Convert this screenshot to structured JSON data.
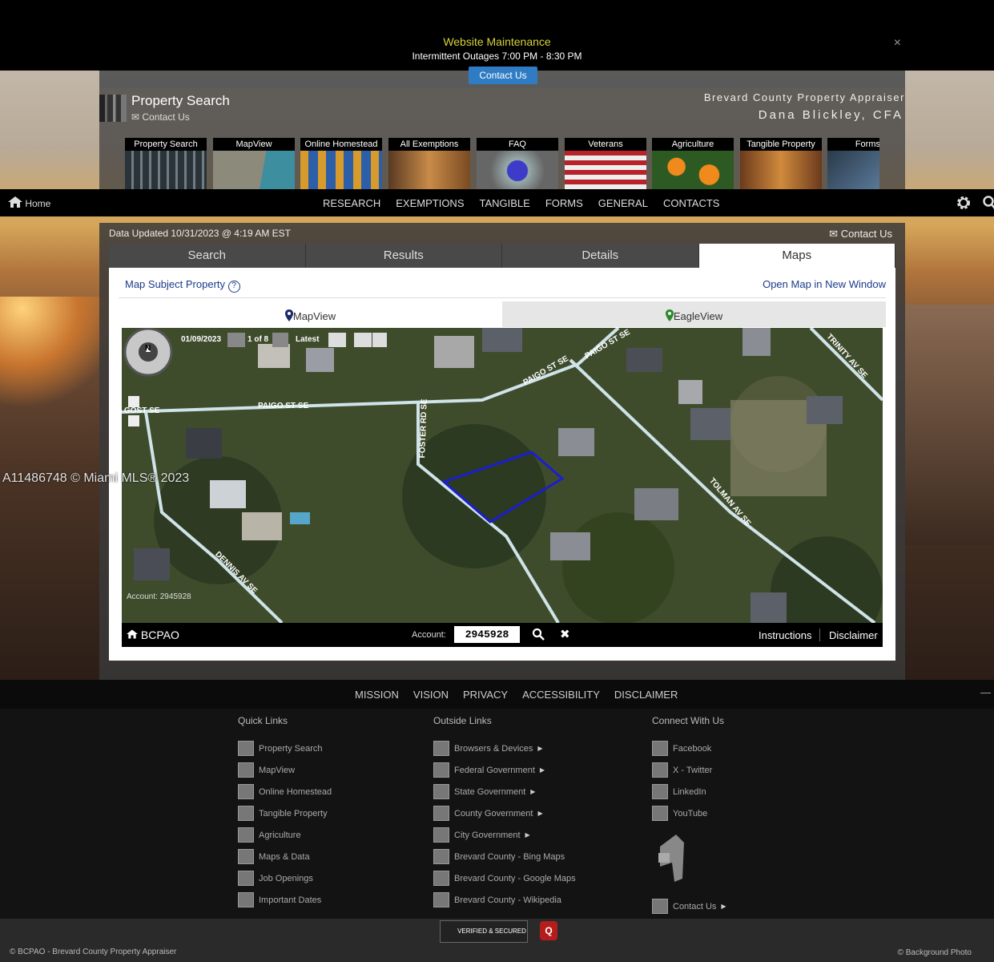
{
  "banner": {
    "title": "Website Maintenance",
    "subtitle": "Intermittent Outages 7:00 PM - 8:30 PM",
    "contact_label": "Contact Us",
    "close_label": "×"
  },
  "header": {
    "title": "Property Search",
    "contact_label": "Contact Us",
    "org": "Brevard County Property Appraiser",
    "appraiser": "Dana Blickley, CFA"
  },
  "tiles": [
    "Property Search",
    "MapView",
    "Online Homestead",
    "All Exemptions",
    "FAQ",
    "Veterans",
    "Agriculture",
    "Tangible Property",
    "Forms"
  ],
  "nav": {
    "home": "Home",
    "items": [
      "RESEARCH",
      "EXEMPTIONS",
      "TANGIBLE",
      "FORMS",
      "GENERAL",
      "CONTACTS"
    ]
  },
  "content": {
    "updated": "Data Updated 10/31/2023 @ 4:19 AM EST",
    "contact_label": "Contact Us",
    "tabs": [
      "Search",
      "Results",
      "Details",
      "Maps"
    ],
    "active_tab": "Maps",
    "map_subject": "Map Subject Property",
    "open_map": "Open Map in New Window",
    "subtabs": [
      "MapView",
      "EagleView"
    ]
  },
  "map": {
    "date": "01/09/2023",
    "page": "1 of 8",
    "latest": "Latest",
    "compass": "N",
    "streets": [
      "PAIGO ST SE",
      "PAIGO ST SE",
      "PAIGO ST SE",
      "GOST SE",
      "FOSTER RD SE",
      "TOLMAN AV SE",
      "DENNIS AV SE",
      "TRINITY AV SE"
    ],
    "account_overlay": "Account: 2945928",
    "bar": {
      "brand": "BCPAO",
      "account_label": "Account:",
      "account_value": "2945928",
      "instructions": "Instructions",
      "disclaimer": "Disclaimer"
    }
  },
  "watermark": "A11486748 © Miami MLS® 2023",
  "footer": {
    "nav": [
      "MISSION",
      "VISION",
      "PRIVACY",
      "ACCESSIBILITY",
      "DISCLAIMER"
    ],
    "dash": "—",
    "quick_title": "Quick Links",
    "quick": [
      "Property Search",
      "MapView",
      "Online Homestead",
      "Tangible Property",
      "Agriculture",
      "Maps & Data",
      "Job Openings",
      "Important Dates"
    ],
    "outside_title": "Outside Links",
    "outside": [
      "Browsers & Devices",
      "Federal Government",
      "State Government",
      "County Government",
      "City Government",
      "Brevard County - Bing Maps",
      "Brevard County - Google Maps",
      "Brevard County - Wikipedia"
    ],
    "connect_title": "Connect With Us",
    "connect": [
      "Facebook",
      "X - Twitter",
      "LinkedIn",
      "YouTube"
    ],
    "contact": "Contact Us",
    "copyright": "© BCPAO - Brevard County Property Appraiser",
    "bg_photo": "© Background Photo",
    "godaddy": "VERIFIED & SECURED",
    "q": "Q"
  }
}
